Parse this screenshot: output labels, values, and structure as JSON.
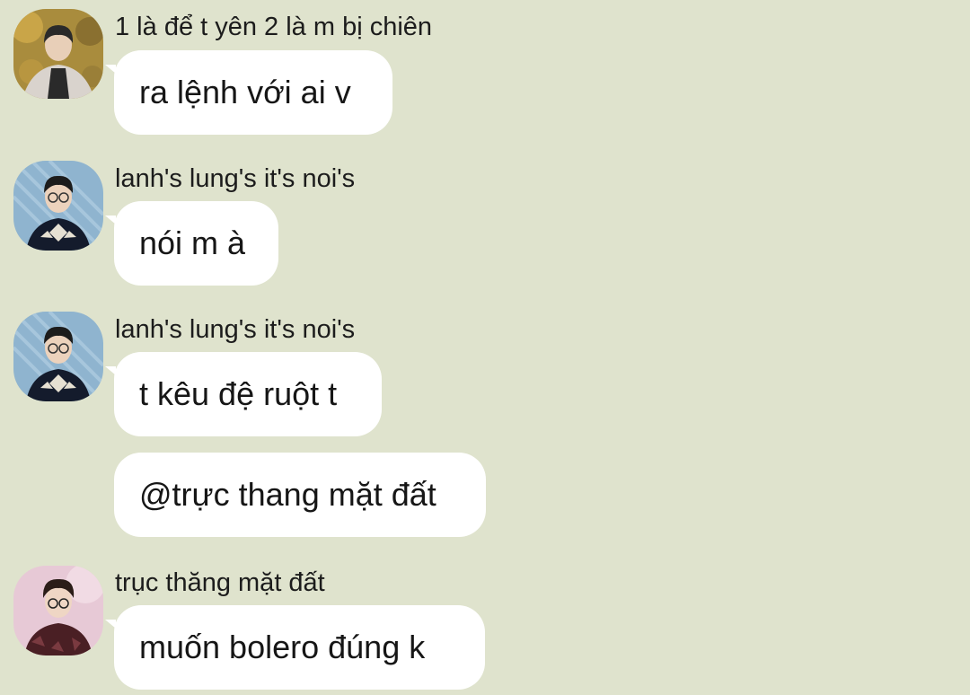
{
  "messages": [
    {
      "sender": "1 là để t yên 2 là m bị chiên",
      "text": "ra lệnh với ai v",
      "avatar": "avatar-photo-man-autumn"
    },
    {
      "sender": "lanh's lung's it's noi's",
      "text": "nói m à",
      "avatar": "avatar-photo-man-sweater"
    },
    {
      "sender": "lanh's lung's it's noi's",
      "text": "t kêu đệ ruột t",
      "avatar": "avatar-photo-man-sweater"
    },
    {
      "text": "@trực thang mặt đất"
    },
    {
      "sender": "trục thăng mặt đất",
      "text": "muốn bolero đúng k",
      "avatar": "avatar-photo-man-glasses"
    }
  ],
  "colors": {
    "background": "#dfe3cd",
    "bubble": "#ffffff",
    "text": "#161616"
  }
}
